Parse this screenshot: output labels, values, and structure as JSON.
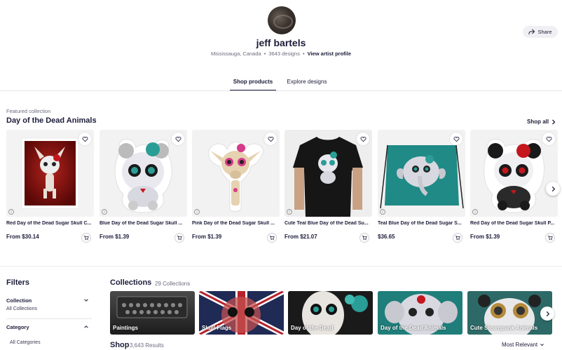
{
  "header": {
    "artist_name": "jeff bartels",
    "location": "Mississauga, Canada",
    "designs": "3643 designs",
    "profile_link": "View artist profile",
    "share_label": "Share"
  },
  "tabs": [
    {
      "label": "Shop products",
      "active": true
    },
    {
      "label": "Explore designs",
      "active": false
    }
  ],
  "featured": {
    "label": "Featured collection",
    "title": "Day of the Dead Animals",
    "shop_all": "Shop all",
    "products": [
      {
        "title": "Red Day of the Dead Sugar Skull C...",
        "price": "From $30.14",
        "icon": "print-icon"
      },
      {
        "title": "Blue Day of the Dead Sugar Skull ...",
        "price": "From $1.39",
        "icon": "sticker-icon"
      },
      {
        "title": "Pink Day of the Dead Sugar Skull ...",
        "price": "From $1.39",
        "icon": "sticker-icon"
      },
      {
        "title": "Cute Teal Blue Day of the Dead Su...",
        "price": "From $21.07",
        "icon": "tshirt-icon"
      },
      {
        "title": "Teal Blue Day of the Dead Sugar S...",
        "price": "$36.65",
        "icon": "bag-icon"
      },
      {
        "title": "Red Day of the Dead Sugar Skull P...",
        "price": "From $1.39",
        "icon": "sticker-icon"
      }
    ]
  },
  "filters": {
    "title": "Filters",
    "collection_title": "Collection",
    "collection_value": "All Collections",
    "category_title": "Category",
    "category_value": "All Categories"
  },
  "collections": {
    "title": "Collections",
    "count": "29 Collections",
    "items": [
      {
        "label": "Paintings"
      },
      {
        "label": "Skull Flags"
      },
      {
        "label": "Day of the Dead"
      },
      {
        "label": "Day of the Dead Animals"
      },
      {
        "label": "Cute Steampunk Animals"
      }
    ]
  },
  "shop": {
    "title": "Shop",
    "count": "3,643 Results",
    "sort": "Most Relevant"
  },
  "colors": {
    "text": "#1c1c3a",
    "muted": "#6c6c80",
    "teal": "#2a9d96",
    "red": "#c4161c"
  }
}
